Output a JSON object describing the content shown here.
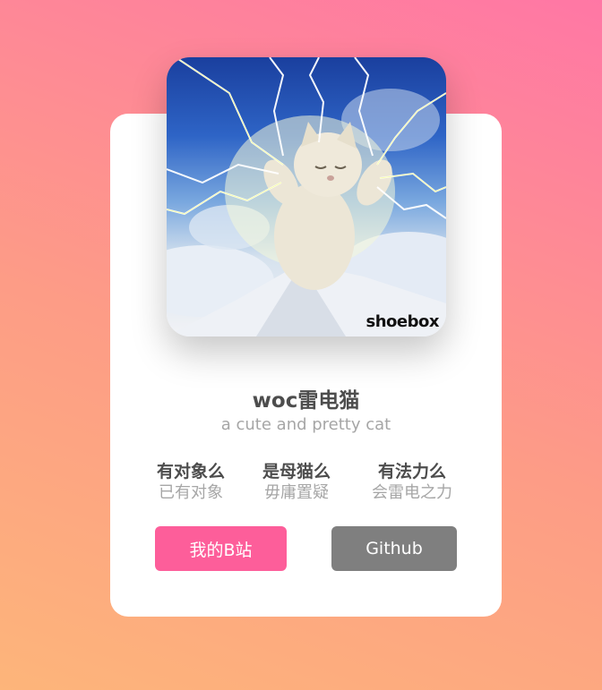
{
  "profile": {
    "name": "woc雷电猫",
    "tagline": "a cute and pretty cat",
    "avatar_watermark": "shoebox",
    "avatar_icon": "lightning-cat-image"
  },
  "stats": [
    {
      "question": "有对象么",
      "answer": "已有对象"
    },
    {
      "question": "是母猫么",
      "answer": "毋庸置疑"
    },
    {
      "question": "有法力么",
      "answer": "会雷电之力"
    }
  ],
  "buttons": {
    "bilibili_label": "我的B站",
    "github_label": "Github"
  },
  "colors": {
    "bilibili_button": "#fd5e9a",
    "github_button": "#7f7f7f",
    "background_start": "#fdb57a",
    "background_end": "#ff77a5"
  }
}
